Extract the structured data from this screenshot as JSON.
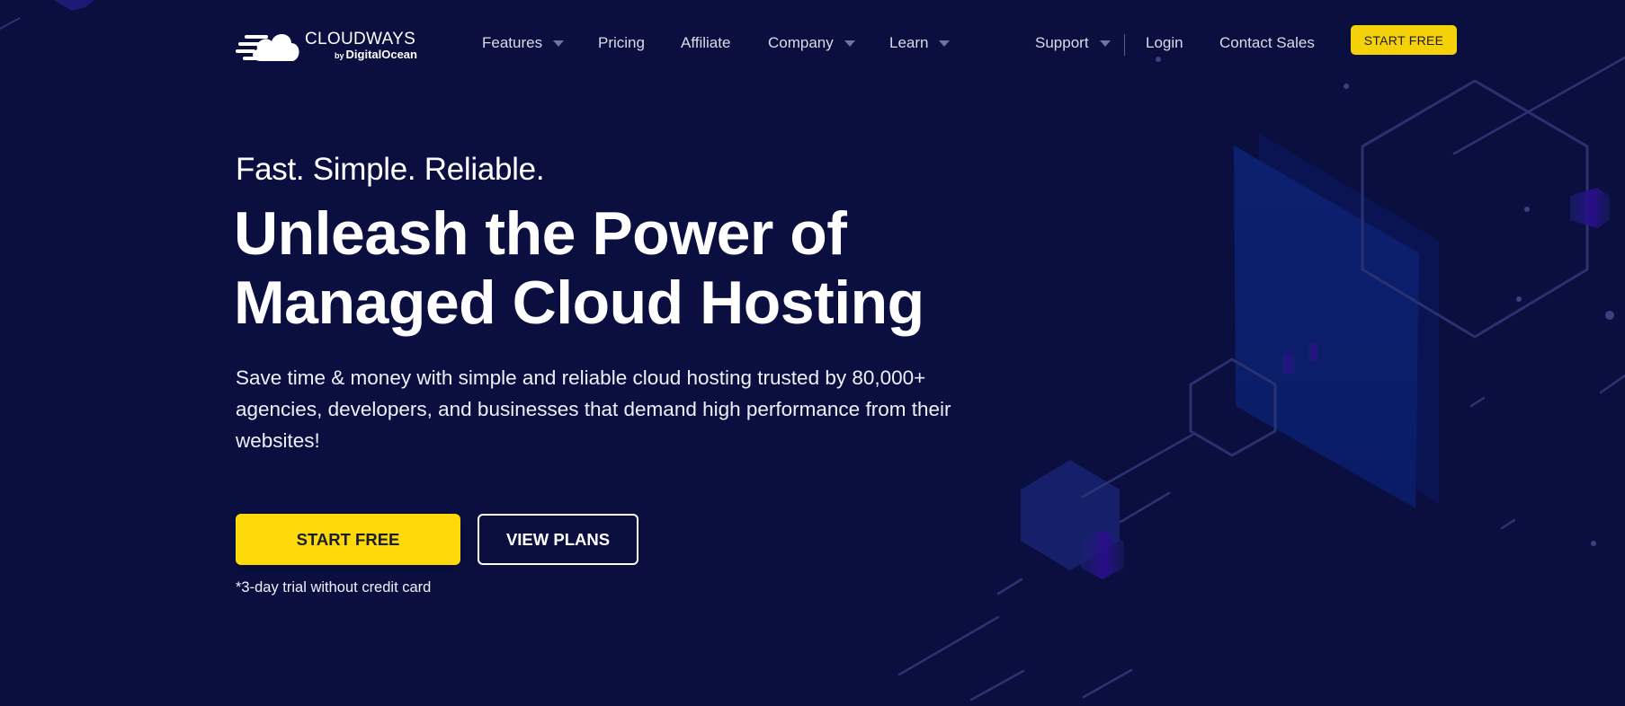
{
  "brand": {
    "name": "CLOUDWAYS",
    "by": "by",
    "parent": "DigitalOcean"
  },
  "nav": {
    "items": [
      {
        "label": "Features",
        "has_dropdown": true
      },
      {
        "label": "Pricing",
        "has_dropdown": false
      },
      {
        "label": "Affiliate",
        "has_dropdown": false
      },
      {
        "label": "Company",
        "has_dropdown": true
      },
      {
        "label": "Learn",
        "has_dropdown": true
      }
    ],
    "support": {
      "label": "Support",
      "has_dropdown": true
    },
    "login": "Login",
    "contact_sales": "Contact Sales",
    "cta": "START FREE"
  },
  "hero": {
    "tagline": "Fast. Simple. Reliable.",
    "headline_line1": "Unleash the Power of",
    "headline_line2": "Managed Cloud Hosting",
    "lead_line1": "Save time & money with simple and reliable cloud hosting trusted by 80,000+",
    "lead_line2": "agencies, developers, and businesses that demand high performance from their",
    "lead_line3": "websites!",
    "primary_button": "START FREE",
    "secondary_button": "VIEW PLANS",
    "disclaimer": "*3-day trial without credit card"
  },
  "colors": {
    "background": "#0b0f40",
    "accent_yellow": "#fdd90a",
    "text": "#ffffff",
    "nav_text": "#d9dbe8"
  }
}
